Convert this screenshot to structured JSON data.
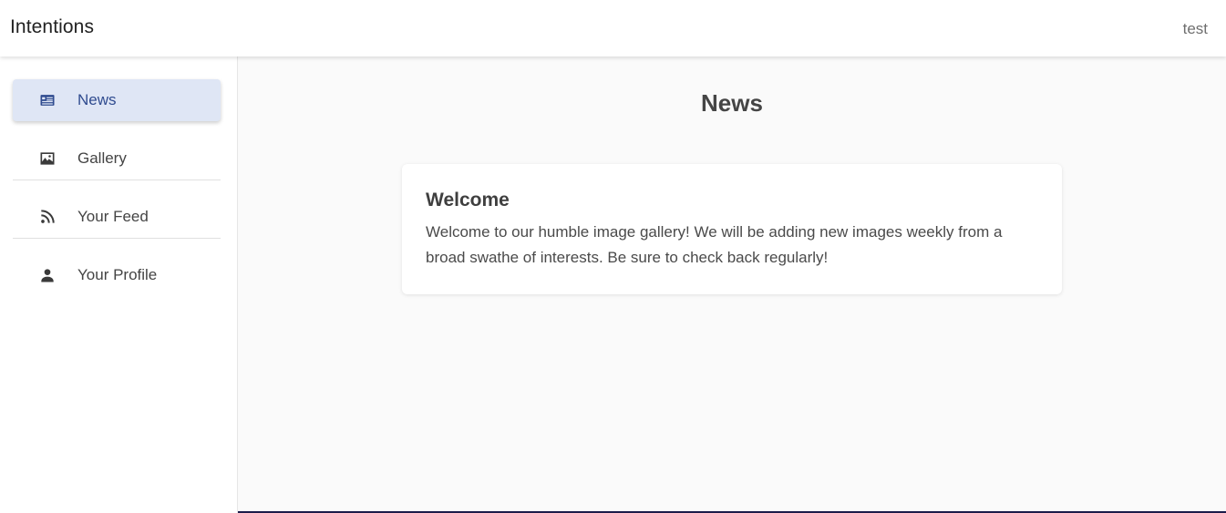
{
  "header": {
    "title": "Intentions",
    "user": "test"
  },
  "sidebar": {
    "items": [
      {
        "label": "News",
        "icon": "newspaper-icon",
        "active": true
      },
      {
        "label": "Gallery",
        "icon": "image-icon",
        "active": false
      },
      {
        "label": "Your Feed",
        "icon": "rss-feed-icon",
        "active": false
      },
      {
        "label": "Your Profile",
        "icon": "person-icon",
        "active": false
      }
    ]
  },
  "main": {
    "title": "News",
    "card": {
      "title": "Welcome",
      "body": "Welcome to our humble image gallery! We will be adding new images weekly from a broad swathe of interests. Be sure to check back regularly!"
    }
  },
  "colors": {
    "accent": "#2f4b8f",
    "active_bg": "#dfe6f5",
    "background": "#fafafa"
  }
}
